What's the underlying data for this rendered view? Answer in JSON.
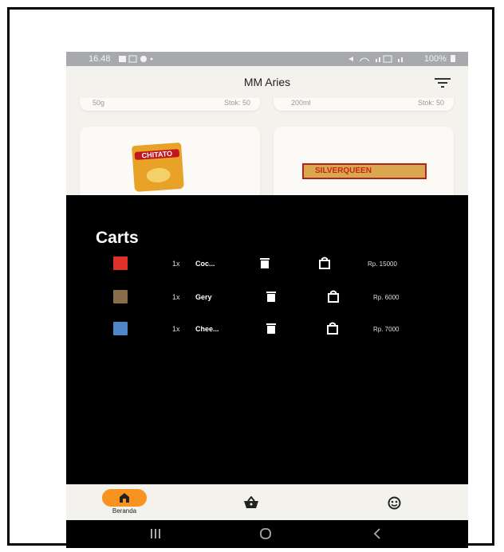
{
  "status_bar": {
    "time": "16.48",
    "battery": "100%"
  },
  "app_bar": {
    "title": "MM Aries"
  },
  "products": {
    "top_left": {
      "size": "50g",
      "stock": "Stok: 50"
    },
    "top_right": {
      "size": "200ml",
      "stock": "Stok: 50"
    },
    "bottom_left": {
      "brand": "CHITATO"
    },
    "bottom_right": {
      "brand": "SILVERQUEEN"
    }
  },
  "cart": {
    "heading": "Carts",
    "items": [
      {
        "qty": "1x",
        "name": "Coc...",
        "price": "Rp. 15000",
        "thumb_color": "#e0302a"
      },
      {
        "qty": "1x",
        "name": "Gery",
        "price": "Rp. 6000",
        "thumb_color": "#8a6d4a"
      },
      {
        "qty": "1x",
        "name": "Chee...",
        "price": "Rp. 7000",
        "thumb_color": "#4f86c9"
      }
    ]
  },
  "bottom_nav": {
    "home_label": "Beranda"
  },
  "colors": {
    "accent": "#f7931e",
    "sheet_bg": "#000000",
    "app_bg": "#f4f2ed"
  }
}
